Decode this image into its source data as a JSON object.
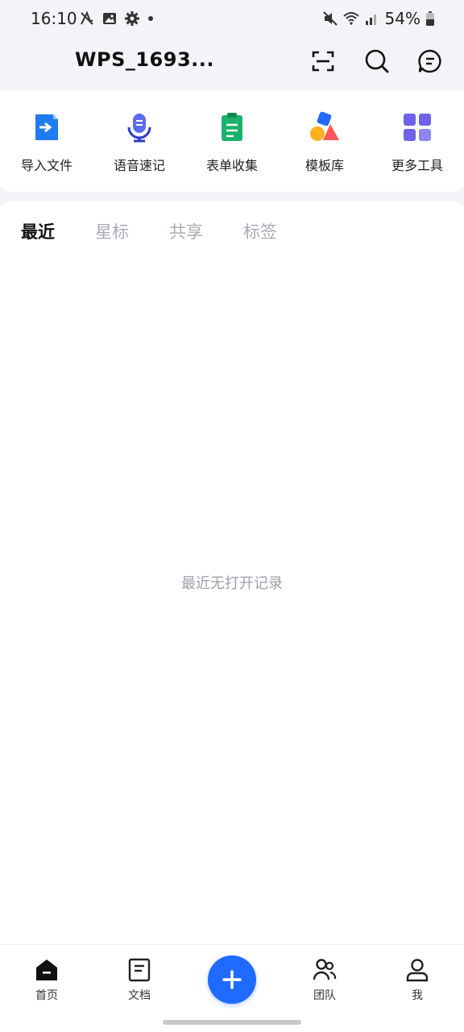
{
  "status_bar": {
    "time": "16:10",
    "left_icons": [
      "muted-app-icon",
      "gallery-icon",
      "settings-icon",
      "dot-icon"
    ],
    "battery_text": "54%",
    "right_icons": [
      "mute-icon",
      "wifi-icon",
      "signal-icon",
      "battery-icon"
    ]
  },
  "header": {
    "account_name": "WPS_1693...",
    "icons": [
      "scan-icon",
      "search-icon",
      "message-icon"
    ]
  },
  "tools": [
    {
      "label": "导入文件",
      "icon": "import-file-icon"
    },
    {
      "label": "语音速记",
      "icon": "microphone-icon"
    },
    {
      "label": "表单收集",
      "icon": "form-collect-icon"
    },
    {
      "label": "模板库",
      "icon": "template-library-icon"
    },
    {
      "label": "更多工具",
      "icon": "more-tools-icon"
    }
  ],
  "tabs": [
    {
      "label": "最近",
      "active": true
    },
    {
      "label": "星标",
      "active": false
    },
    {
      "label": "共享",
      "active": false
    },
    {
      "label": "标签",
      "active": false
    }
  ],
  "empty_state": "最近无打开记录",
  "bottom_nav": [
    {
      "label": "首页",
      "icon": "home-icon"
    },
    {
      "label": "文档",
      "icon": "document-icon"
    },
    {
      "label": "团队",
      "icon": "team-icon"
    },
    {
      "label": "我",
      "icon": "profile-icon"
    }
  ],
  "colors": {
    "accent": "#1f6bff",
    "background": "#f3f4f7",
    "inactive_tab": "#a7abb3"
  }
}
